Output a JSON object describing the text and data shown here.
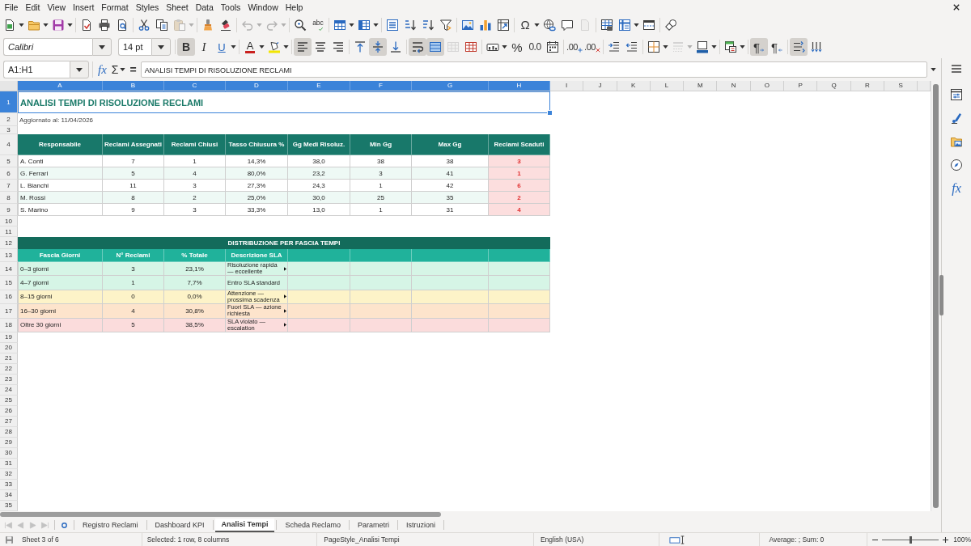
{
  "menu_bar": [
    "File",
    "Edit",
    "View",
    "Insert",
    "Format",
    "Styles",
    "Sheet",
    "Data",
    "Tools",
    "Window",
    "Help"
  ],
  "standard_toolbar": [
    [
      {
        "dropdown": true,
        "disabled": false
      },
      {
        "dropdown": true,
        "disabled": false
      },
      {
        "dropdown": true,
        "disabled": false
      }
    ],
    [
      {
        "dropdown": false,
        "disabled": false
      },
      {
        "dropdown": false,
        "disabled": false
      },
      {
        "dropdown": false,
        "disabled": false
      }
    ],
    [
      {
        "dropdown": false,
        "disabled": false
      },
      {
        "dropdown": false,
        "disabled": false
      },
      {
        "dropdown": true,
        "disabled": true
      }
    ],
    [
      {
        "dropdown": false,
        "disabled": false
      },
      {
        "dropdown": false,
        "disabled": false
      }
    ],
    [
      {
        "dropdown": true,
        "disabled": true
      },
      {
        "dropdown": true,
        "disabled": true
      }
    ],
    [
      {
        "dropdown": false,
        "disabled": false
      },
      {
        "label": "abc",
        "dropdown": false,
        "disabled": false
      }
    ],
    [
      {
        "dropdown": true,
        "disabled": false
      },
      {
        "dropdown": true,
        "disabled": false
      }
    ],
    [
      {
        "dropdown": false,
        "disabled": false
      },
      {
        "dropdown": false,
        "disabled": false
      },
      {
        "dropdown": false,
        "disabled": false
      },
      {
        "dropdown": false,
        "disabled": false
      }
    ],
    [
      {
        "dropdown": false,
        "disabled": false
      },
      {
        "dropdown": false,
        "disabled": false
      },
      {
        "dropdown": false,
        "disabled": false
      }
    ],
    [
      {
        "label": "Ω",
        "dropdown": true,
        "disabled": false
      },
      {
        "dropdown": false,
        "disabled": false
      },
      {
        "dropdown": false,
        "disabled": false
      },
      {
        "dropdown": false,
        "disabled": true
      }
    ],
    [
      {
        "dropdown": false,
        "disabled": false
      },
      {
        "dropdown": true,
        "disabled": false
      },
      {
        "dropdown": false,
        "disabled": false
      }
    ],
    [
      {
        "dropdown": false,
        "disabled": false
      }
    ]
  ],
  "font_name": "Calibri",
  "font_size": "14 pt",
  "formatting_toolbar": [
    [
      {
        "label": "B",
        "selected": true,
        "dropdown": false,
        "disabled": false
      },
      {
        "label": "I",
        "selected": false,
        "dropdown": false,
        "disabled": false
      },
      {
        "label": "U",
        "selected": false,
        "dropdown": true,
        "disabled": false
      }
    ],
    [
      {
        "label": "A",
        "selected": false,
        "dropdown": true,
        "disabled": false
      },
      {
        "selected": false,
        "dropdown": true,
        "disabled": false
      }
    ],
    [
      {
        "selected": true,
        "dropdown": false,
        "disabled": false
      },
      {
        "selected": false,
        "dropdown": false,
        "disabled": false
      },
      {
        "selected": false,
        "dropdown": false,
        "disabled": false
      }
    ],
    [
      {
        "selected": false,
        "dropdown": false,
        "disabled": false
      },
      {
        "selected": true,
        "dropdown": false,
        "disabled": false
      },
      {
        "selected": false,
        "dropdown": false,
        "disabled": false
      }
    ],
    [
      {
        "selected": true,
        "dropdown": false,
        "disabled": false
      },
      {
        "selected": true,
        "dropdown": false,
        "disabled": false
      },
      {
        "selected": false,
        "dropdown": false,
        "disabled": true
      },
      {
        "selected": false,
        "dropdown": false,
        "disabled": false
      }
    ],
    [
      {
        "selected": false,
        "dropdown": true,
        "disabled": false
      },
      {
        "label": "%",
        "selected": false,
        "dropdown": false,
        "disabled": false
      },
      {
        "label": "0.0",
        "selected": false,
        "dropdown": false,
        "disabled": false
      },
      {
        "selected": false,
        "dropdown": false,
        "disabled": false
      }
    ],
    [
      {
        "label": ".00",
        "selected": false,
        "dropdown": false,
        "disabled": false
      },
      {
        "label": ".00",
        "selected": false,
        "dropdown": false,
        "disabled": false
      }
    ],
    [
      {
        "selected": false,
        "dropdown": false,
        "disabled": false
      },
      {
        "selected": false,
        "dropdown": false,
        "disabled": false
      }
    ],
    [
      {
        "selected": false,
        "dropdown": true,
        "disabled": false
      },
      {
        "selected": false,
        "dropdown": true,
        "disabled": true
      },
      {
        "selected": false,
        "dropdown": true,
        "disabled": false
      }
    ],
    [
      {
        "selected": false,
        "dropdown": true,
        "disabled": false
      }
    ],
    [
      {
        "label": "¶",
        "selected": true,
        "dropdown": false,
        "disabled": false
      },
      {
        "label": "¶",
        "selected": false,
        "dropdown": false,
        "disabled": false
      }
    ],
    [
      {
        "selected": true,
        "dropdown": false,
        "disabled": false
      },
      {
        "selected": false,
        "dropdown": false,
        "disabled": false
      }
    ]
  ],
  "formula_bar": {
    "name_box": "A1:H1",
    "function_wizard": "fx",
    "sum": "Σ",
    "equals": "=",
    "content": "ANALISI TEMPI DI RISOLUZIONE RECLAMI"
  },
  "sidebar": {
    "functions": "fx"
  },
  "columns": [
    {
      "label": "A",
      "selected": true
    },
    {
      "label": "B",
      "selected": true
    },
    {
      "label": "C",
      "selected": true
    },
    {
      "label": "D",
      "selected": true
    },
    {
      "label": "E",
      "selected": true
    },
    {
      "label": "F",
      "selected": true
    },
    {
      "label": "G",
      "selected": true
    },
    {
      "label": "H",
      "selected": true
    },
    {
      "label": "I",
      "selected": false
    },
    {
      "label": "J",
      "selected": false
    },
    {
      "label": "K",
      "selected": false
    },
    {
      "label": "L",
      "selected": false
    },
    {
      "label": "M",
      "selected": false
    },
    {
      "label": "N",
      "selected": false
    },
    {
      "label": "O",
      "selected": false
    },
    {
      "label": "P",
      "selected": false
    },
    {
      "label": "Q",
      "selected": false
    },
    {
      "label": "R",
      "selected": false
    },
    {
      "label": "S",
      "selected": false
    }
  ],
  "row_headers": [
    {
      "label": "1",
      "selected": true
    },
    {
      "label": "2",
      "selected": false
    },
    {
      "label": "3",
      "selected": false
    },
    {
      "label": "4",
      "selected": false
    },
    {
      "label": "5",
      "selected": false
    },
    {
      "label": "6",
      "selected": false
    },
    {
      "label": "7",
      "selected": false
    },
    {
      "label": "8",
      "selected": false
    },
    {
      "label": "9",
      "selected": false
    },
    {
      "label": "10",
      "selected": false
    },
    {
      "label": "11",
      "selected": false
    },
    {
      "label": "12",
      "selected": false
    },
    {
      "label": "13",
      "selected": false
    },
    {
      "label": "14",
      "selected": false
    },
    {
      "label": "15",
      "selected": false
    },
    {
      "label": "16",
      "selected": false
    },
    {
      "label": "17",
      "selected": false
    },
    {
      "label": "18",
      "selected": false
    },
    {
      "label": "19",
      "selected": false
    },
    {
      "label": "20",
      "selected": false
    },
    {
      "label": "21",
      "selected": false
    },
    {
      "label": "22",
      "selected": false
    },
    {
      "label": "23",
      "selected": false
    },
    {
      "label": "24",
      "selected": false
    },
    {
      "label": "25",
      "selected": false
    },
    {
      "label": "26",
      "selected": false
    },
    {
      "label": "27",
      "selected": false
    },
    {
      "label": "28",
      "selected": false
    },
    {
      "label": "29",
      "selected": false
    },
    {
      "label": "30",
      "selected": false
    },
    {
      "label": "31",
      "selected": false
    },
    {
      "label": "32",
      "selected": false
    },
    {
      "label": "33",
      "selected": false
    },
    {
      "label": "34",
      "selected": false
    },
    {
      "label": "35",
      "selected": false
    }
  ],
  "title": {
    "text": "ANALISI TEMPI DI RISOLUZIONE RECLAMI",
    "selected": true
  },
  "updated": "Aggiornato al: 11/04/2026",
  "summary_table": {
    "columns": [
      {
        "label": "Responsabile",
        "alert": false
      },
      {
        "label": "Reclami Assegnati",
        "alert": false
      },
      {
        "label": "Reclami Chiusi",
        "alert": false
      },
      {
        "label": "Tasso Chiusura %",
        "alert": false
      },
      {
        "label": "Gg Medi Risoluz.",
        "alert": false
      },
      {
        "label": "Min Gg",
        "alert": false
      },
      {
        "label": "Max Gg",
        "alert": false
      },
      {
        "label": "Reclami Scaduti",
        "alert": true
      }
    ],
    "rows": [
      [
        "A. Conti",
        "7",
        "1",
        "14,3%",
        "38,0",
        "38",
        "38",
        "3"
      ],
      [
        "G. Ferrari",
        "5",
        "4",
        "80,0%",
        "23,2",
        "3",
        "41",
        "1"
      ],
      [
        "L. Bianchi",
        "11",
        "3",
        "27,3%",
        "24,3",
        "1",
        "42",
        "6"
      ],
      [
        "M. Rossi",
        "8",
        "2",
        "25,0%",
        "30,0",
        "25",
        "35",
        "2"
      ],
      [
        "S. Marino",
        "9",
        "3",
        "33,3%",
        "13,0",
        "1",
        "31",
        "4"
      ]
    ]
  },
  "distribution_table": {
    "title": "DISTRIBUZIONE PER FASCIA TEMPI",
    "columns": [
      "Fascia Giorni",
      "N° Reclami",
      "% Totale",
      "Descrizione SLA"
    ],
    "rows": [
      {
        "cells": [
          "0–3 giorni",
          "3",
          "23,1%",
          "Risoluzione rapida — eccellente"
        ],
        "color": "#d6f5e6",
        "overflow": true
      },
      {
        "cells": [
          "4–7 giorni",
          "1",
          "7,7%",
          "Entro SLA standard"
        ],
        "color": "#d6f5e6",
        "overflow": false
      },
      {
        "cells": [
          "8–15 giorni",
          "0",
          "0,0%",
          "Attenzione — prossima scadenza"
        ],
        "color": "#fdf3c8",
        "overflow": true
      },
      {
        "cells": [
          "16–30 giorni",
          "4",
          "30,8%",
          "Fuori SLA — azione richiesta"
        ],
        "color": "#fde4cc",
        "overflow": true
      },
      {
        "cells": [
          "Oltre 30 giorni",
          "5",
          "38,5%",
          "SLA violato — escalation"
        ],
        "color": "#fbdcdc",
        "overflow": true
      }
    ]
  },
  "tab_navigation": [
    {
      "disabled": true
    },
    {
      "disabled": true
    },
    {
      "disabled": true
    },
    {
      "disabled": true
    }
  ],
  "sheet_tabs": [
    {
      "label": "Registro Reclami",
      "selected": false
    },
    {
      "label": "Dashboard KPI",
      "selected": false
    },
    {
      "label": "Analisi Tempi",
      "selected": true
    },
    {
      "label": "Scheda Reclamo",
      "selected": false
    },
    {
      "label": "Parametri",
      "selected": false
    },
    {
      "label": "Istruzioni",
      "selected": false
    }
  ],
  "status_bar": {
    "sheet": "Sheet 3 of 6",
    "selection": "Selected: 1 row, 8 columns",
    "page_style": "PageStyle_Analisi Tempi",
    "language": "English (USA)",
    "statistics": "Average: ; Sum: 0",
    "zoom": {
      "label": "100%",
      "level": 0.5
    }
  }
}
